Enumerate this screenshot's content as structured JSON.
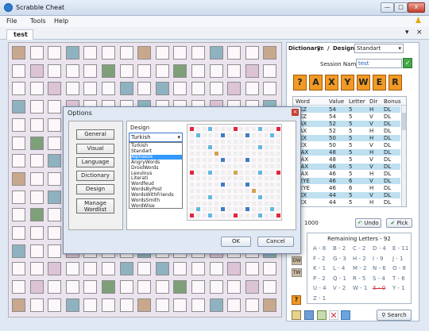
{
  "app": {
    "title": "Scrabble Cheat"
  },
  "window": {
    "minimize": "—",
    "maximize": "□",
    "close": "X"
  },
  "menu": [
    "File",
    "Tools",
    "Help"
  ],
  "tab": {
    "label": "test",
    "close": "×",
    "pin": "▾"
  },
  "dictionary": {
    "label": "Dictionary:",
    "value": "En",
    "sep": "/",
    "design_label": "Design:",
    "design_value": "Standart"
  },
  "session": {
    "label": "Session Name:",
    "value": "test"
  },
  "rack": [
    "?",
    "A",
    "X",
    "Y",
    "W",
    "E",
    "R"
  ],
  "words": {
    "headers": [
      "Word",
      "Value",
      "Letter",
      "Dir",
      "Bonus"
    ],
    "rows": [
      [
        "REZ",
        "54",
        "5",
        "H",
        "DL"
      ],
      [
        "REZ",
        "54",
        "5",
        "V",
        "DL"
      ],
      [
        "RAX",
        "52",
        "5",
        "V",
        "DL"
      ],
      [
        "RAX",
        "52",
        "5",
        "H",
        "DL"
      ],
      [
        "REX",
        "50",
        "5",
        "H",
        "DL"
      ],
      [
        "REX",
        "50",
        "5",
        "V",
        "DL"
      ],
      [
        "WAX",
        "48",
        "5",
        "H",
        "DL"
      ],
      [
        "WAX",
        "48",
        "5",
        "V",
        "DL"
      ],
      [
        "WAX",
        "46",
        "5",
        "V",
        "DL"
      ],
      [
        "WAX",
        "46",
        "5",
        "H",
        "DL"
      ],
      [
        "XEYE",
        "46",
        "6",
        "V",
        "DL"
      ],
      [
        "XEYE",
        "46",
        "6",
        "H",
        "DL"
      ],
      [
        "REX",
        "44",
        "5",
        "V",
        "DL"
      ],
      [
        "REX",
        "44",
        "5",
        "H",
        "DL"
      ]
    ]
  },
  "count": "1000",
  "undo": "Undo",
  "pick": "Pick",
  "remaining": {
    "title": "Remaining Letters - 92",
    "items": [
      "A - 8",
      "B - 2",
      "C - 2",
      "D - 4",
      "E - 11",
      "F - 2",
      "G - 3",
      "H - 2",
      "I - 9",
      "J - 1",
      "K - 1",
      "L - 4",
      "M - 2",
      "N - 6",
      "O - 8",
      "P - 2",
      "Q - 1",
      "R - 5",
      "S - 4",
      "T - 6",
      "U - 4",
      "V - 2",
      "W - 1",
      "X - 0",
      "Y - 1",
      "Z - 1"
    ]
  },
  "bonus_labels": [
    "DW",
    "TW"
  ],
  "search": "Search",
  "dialog": {
    "title": "Options",
    "sections": [
      "General",
      "Visual",
      "Language",
      "Dictionary",
      "Design",
      "Manage Wordlist"
    ],
    "design_label": "Design",
    "selected": "Turkish",
    "options": [
      "Turkish",
      "Standart",
      "Alphasox",
      "AngryWords",
      "DroidWords",
      "Lexulous",
      "Literati",
      "Wordfeud",
      "WordsByPost",
      "WordsWithFriends",
      "WordsSmith",
      "WordWise"
    ],
    "ok": "OK",
    "cancel": "Cancel"
  },
  "colors": {
    "dl": "#8eb2c0",
    "tl": "#7ea079",
    "dw": "#dcc3d6",
    "tw": "#c8a88c",
    "star": "#d22f3c"
  }
}
